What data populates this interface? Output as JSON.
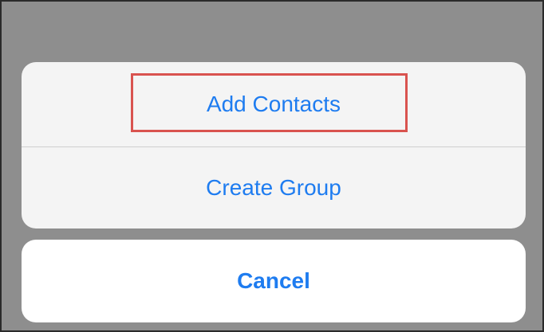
{
  "action_sheet": {
    "items": [
      {
        "label": "Add Contacts",
        "highlighted": true
      },
      {
        "label": "Create Group",
        "highlighted": false
      }
    ],
    "cancel_label": "Cancel"
  },
  "colors": {
    "overlay": "#8e8e8e",
    "sheet_background": "#f4f4f4",
    "cancel_background": "#ffffff",
    "action_text": "#1e7cf0",
    "highlight_border": "#d9534f",
    "frame_border": "#2a2a2a"
  }
}
